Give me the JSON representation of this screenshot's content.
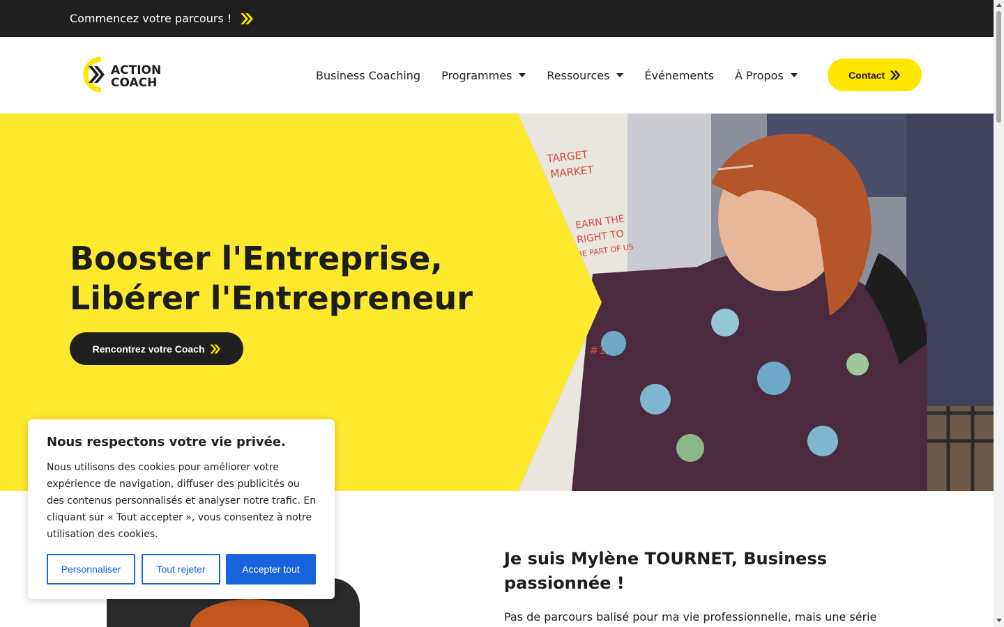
{
  "topbar": {
    "link_text": "Commencez votre parcours !",
    "icon": "double-chevron-right-icon"
  },
  "header": {
    "logo_text_line1": "ACTION",
    "logo_text_line2": "COACH",
    "nav": [
      {
        "label": "Business Coaching",
        "dropdown": false
      },
      {
        "label": "Programmes",
        "dropdown": true
      },
      {
        "label": "Ressources",
        "dropdown": true
      },
      {
        "label": "Événements",
        "dropdown": false
      },
      {
        "label": "À Propos",
        "dropdown": true
      }
    ],
    "contact_label": "Contact"
  },
  "hero": {
    "title_line1": "Booster l'Entreprise,",
    "title_line2": "Libérer l'Entrepreneur",
    "cta_label": "Rencontrez votre Coach",
    "flipchart_text": [
      "TARGET",
      "MARKET",
      "EARN THE",
      "RIGHT TO",
      "BE PART OF US",
      "#1"
    ]
  },
  "intro": {
    "title": "Je suis Mylène TOURNET, Business passionnée !",
    "text": "Pas de parcours balisé pour ma vie professionnelle, mais une série"
  },
  "cookie": {
    "title": "Nous respectons votre vie privée.",
    "text": "Nous utilisons des cookies pour améliorer votre expérience de navigation, diffuser des publicités ou des contenus personnalisés et analyser notre trafic. En cliquant sur « Tout accepter », vous consentez à notre utilisation des cookies.",
    "customize_label": "Personnaliser",
    "reject_label": "Tout rejeter",
    "accept_label": "Accepter tout"
  },
  "colors": {
    "brand_yellow": "#fdea2e",
    "button_yellow": "#ffe600",
    "dark": "#1f1f1f",
    "cookie_blue": "#1863dc"
  }
}
